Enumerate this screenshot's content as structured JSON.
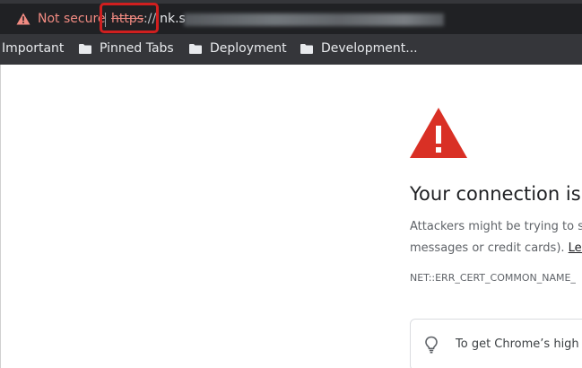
{
  "omnibox": {
    "security_label": "Not secure",
    "scheme": "https",
    "separator": "://",
    "host_visible": "ink.s",
    "icon": "warning-triangle-icon",
    "security_color": "#f28b82"
  },
  "bookmarks": {
    "items": [
      {
        "label": "Important",
        "icon": null
      },
      {
        "label": "Pinned Tabs",
        "icon": "folder-icon"
      },
      {
        "label": "Deployment",
        "icon": "folder-icon"
      },
      {
        "label": "Development...",
        "icon": "folder-icon"
      }
    ]
  },
  "interstitial": {
    "icon": "red-warning-triangle-icon",
    "icon_color": "#d93025",
    "heading": "Your connection is",
    "line1": "Attackers might be trying to s",
    "line2_prefix": "messages or credit cards). ",
    "line2_link": "Lea",
    "error_code": "NET::ERR_CERT_COMMON_NAME_",
    "tip_icon": "lightbulb-icon",
    "tip_text": "To get Chrome’s high"
  }
}
